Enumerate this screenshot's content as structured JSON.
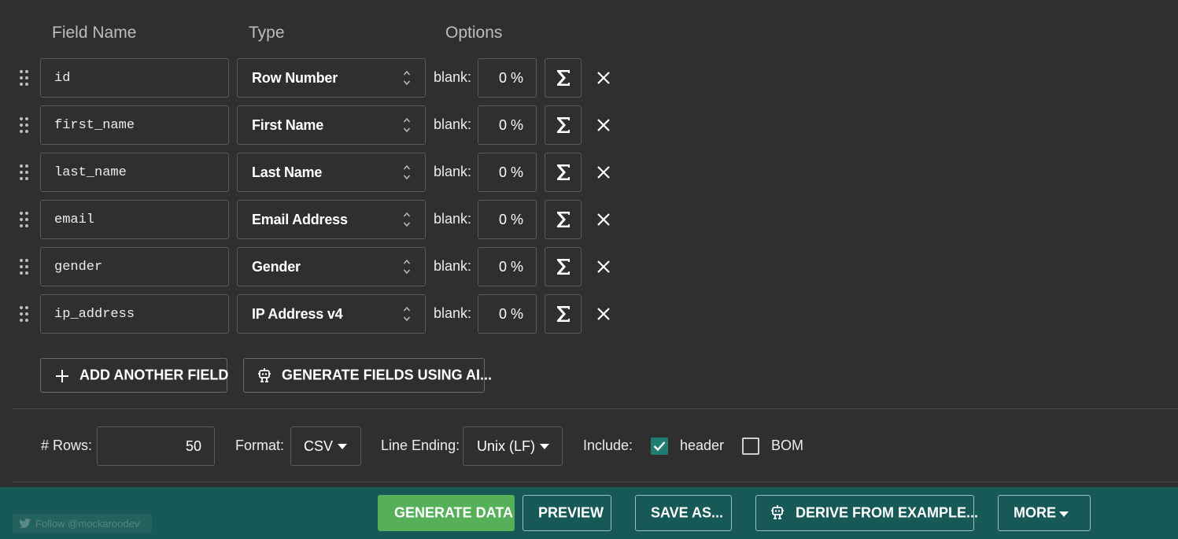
{
  "columns": {
    "field_name": "Field Name",
    "type": "Type",
    "options": "Options"
  },
  "fields": [
    {
      "name": "id",
      "type": "Row Number",
      "blank_label": "blank:",
      "blank_pct": "0 %"
    },
    {
      "name": "first_name",
      "type": "First Name",
      "blank_label": "blank:",
      "blank_pct": "0 %"
    },
    {
      "name": "last_name",
      "type": "Last Name",
      "blank_label": "blank:",
      "blank_pct": "0 %"
    },
    {
      "name": "email",
      "type": "Email Address",
      "blank_label": "blank:",
      "blank_pct": "0 %"
    },
    {
      "name": "gender",
      "type": "Gender",
      "blank_label": "blank:",
      "blank_pct": "0 %"
    },
    {
      "name": "ip_address",
      "type": "IP Address v4",
      "blank_label": "blank:",
      "blank_pct": "0 %"
    }
  ],
  "actions": {
    "add_field": "ADD ANOTHER FIELD",
    "generate_ai": "GENERATE FIELDS USING AI..."
  },
  "options": {
    "rows_label": "# Rows:",
    "rows_value": "50",
    "format_label": "Format:",
    "format_value": "CSV",
    "line_ending_label": "Line Ending:",
    "line_ending_value": "Unix (LF)",
    "include_label": "Include:",
    "header_label": "header",
    "header_checked": true,
    "bom_label": "BOM",
    "bom_checked": false
  },
  "footer": {
    "follow_label": "Follow @mockaroodev",
    "generate": "GENERATE DATA",
    "preview": "PREVIEW",
    "save_as": "SAVE AS...",
    "derive": "DERIVE FROM EXAMPLE...",
    "more": "MORE"
  },
  "colors": {
    "background": "#2f2f2f",
    "footer": "#175956",
    "generate_button": "#56b05a",
    "checkbox_checked": "#1f7d72"
  },
  "icons": {
    "drag": "drag-handle-icon",
    "type_select": "up-down-chevron-icon",
    "formula": "sigma-icon",
    "delete": "close-icon",
    "add": "plus-icon",
    "ai": "robot-icon",
    "dropdown": "caret-down-icon",
    "checkbox": "check-icon"
  }
}
